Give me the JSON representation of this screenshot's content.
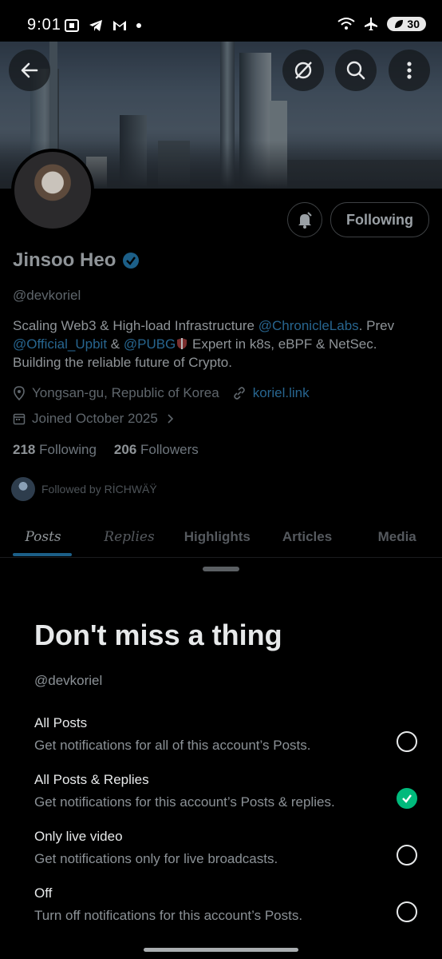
{
  "status_bar": {
    "time": "9:01",
    "battery": "30"
  },
  "profile": {
    "name": "Jinsoo Heo",
    "handle": "@devkoriel",
    "bio_parts": {
      "p1": "Scaling Web3 & High-load Infrastructure ",
      "m1": "@ChronicleLabs",
      "p2": ". Prev",
      "m2": "@Official_Upbit",
      "p3": " & ",
      "m3": "@PUBG",
      "p4": " Expert in k8s, eBPF & NetSec.",
      "p5": "Building the reliable future of Crypto."
    },
    "location": "Yongsan-gu, Republic of Korea",
    "website": "koriel.link",
    "joined": "Joined October 2025",
    "following_count": "218",
    "following_label": "Following",
    "followers_count": "206",
    "followers_label": "Followers",
    "followed_by": "Followed by RİCHWÄŸ",
    "follow_button": "Following"
  },
  "tabs": [
    {
      "label": "Posts"
    },
    {
      "label": "Replies"
    },
    {
      "label": "Highlights"
    },
    {
      "label": "Articles"
    },
    {
      "label": "Media"
    }
  ],
  "sheet": {
    "title": "Don't miss a thing",
    "handle": "@devkoriel",
    "options": [
      {
        "title": "All Posts",
        "desc": "Get notifications for all of this account’s Posts."
      },
      {
        "title": "All Posts & Replies",
        "desc": "Get notifications for this account’s Posts & replies."
      },
      {
        "title": "Only live video",
        "desc": "Get notifications only for live broadcasts."
      },
      {
        "title": "Off",
        "desc": "Turn off notifications for this account’s Posts."
      }
    ],
    "selected_option": "All Posts & Replies"
  },
  "colors": {
    "accent": "#1d9bf0",
    "check": "#00ba7c",
    "background": "#000000"
  }
}
